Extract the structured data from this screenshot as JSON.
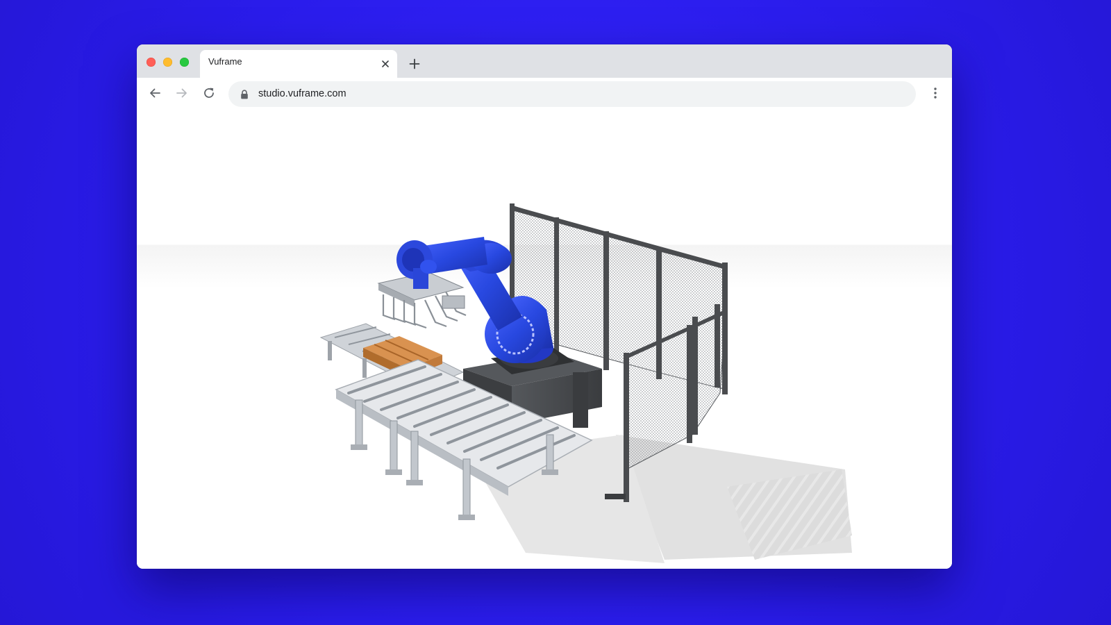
{
  "browser": {
    "tab": {
      "title": "Vuframe"
    },
    "address_bar": {
      "url": "studio.vuframe.com"
    }
  },
  "colors": {
    "background": "#2d1ff2",
    "robot": "#2848e0",
    "pallet": "#c8823f",
    "fence": "#4a4c4f",
    "conveyor": "#c9cdd2"
  },
  "icons": {
    "close": "close-icon",
    "new_tab": "plus-icon",
    "back": "arrow-left-icon",
    "forward": "arrow-right-icon",
    "reload": "reload-icon",
    "lock": "lock-icon",
    "menu": "kebab-menu-icon"
  },
  "scene": {
    "objects": [
      "industrial-robot-arm",
      "gripper",
      "wooden-pallet",
      "roller-conveyor-input",
      "roller-conveyor-output",
      "robot-base",
      "safety-fence"
    ]
  }
}
